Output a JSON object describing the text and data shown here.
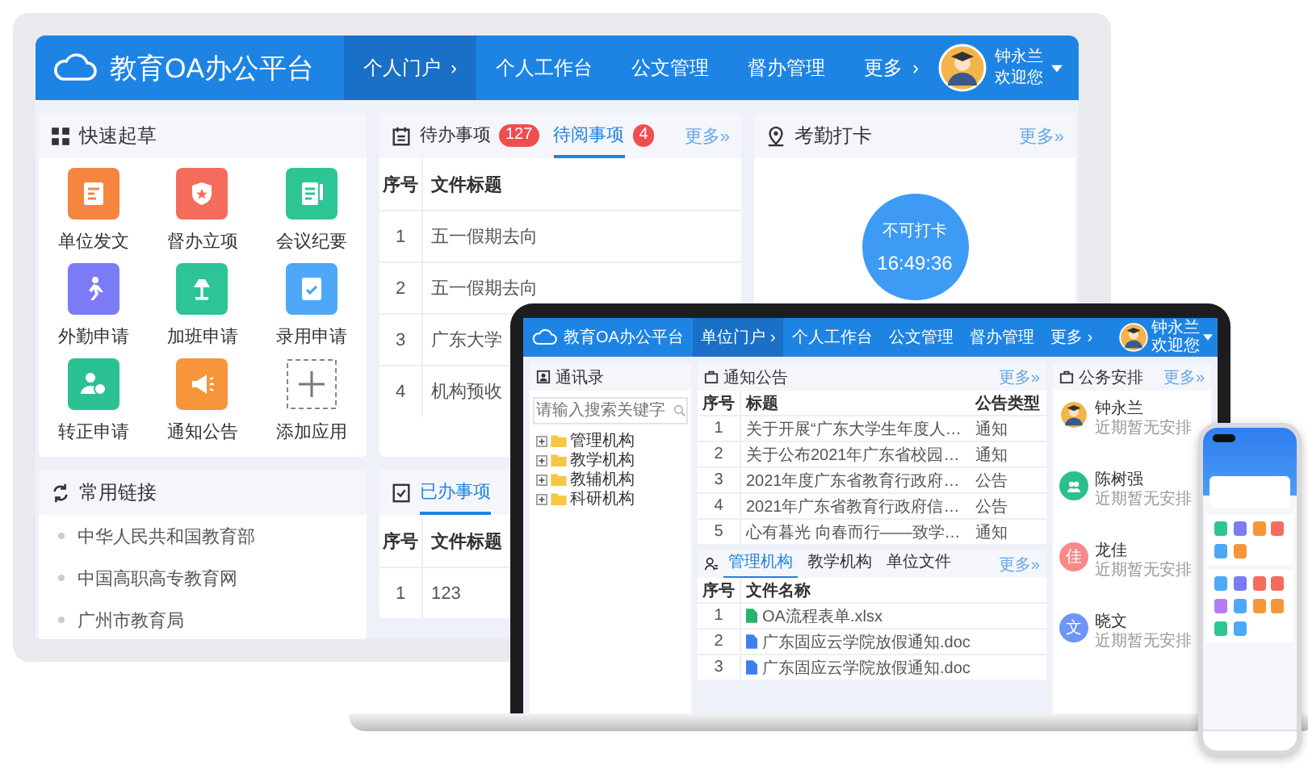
{
  "desktop": {
    "header": {
      "title": "教育OA办公平台",
      "nav": [
        {
          "label": "个人门户",
          "arrow": "›",
          "selected": true
        },
        {
          "label": "个人工作台",
          "selected": false
        },
        {
          "label": "公文管理",
          "selected": false
        },
        {
          "label": "督办管理",
          "selected": false
        },
        {
          "label": "更多",
          "arrow": "›",
          "selected": false
        }
      ],
      "user": {
        "name": "钟永兰",
        "greeting": "欢迎您"
      }
    },
    "quick_draft": {
      "title": "快速起草",
      "apps": [
        {
          "kind": "app",
          "label": "单位发文",
          "color": "#f5853f"
        },
        {
          "kind": "app",
          "label": "督办立项",
          "color": "#f56c5c"
        },
        {
          "kind": "app",
          "label": "会议纪要",
          "color": "#2ec595"
        },
        {
          "kind": "app",
          "label": "外勤申请",
          "color": "#7b7cf5"
        },
        {
          "kind": "app",
          "label": "加班申请",
          "color": "#2dc497"
        },
        {
          "kind": "app",
          "label": "录用申请",
          "color": "#4ea8f7"
        },
        {
          "kind": "app",
          "label": "转正申请",
          "color": "#2bc193"
        },
        {
          "kind": "app",
          "label": "通知公告",
          "color": "#f7953a"
        },
        {
          "kind": "add",
          "label": "添加应用"
        }
      ]
    },
    "links": {
      "title": "常用链接",
      "items": [
        "中华人民共和国教育部",
        "中国高职高专教育网",
        "广州市教育局"
      ]
    },
    "pending": {
      "tabs": [
        {
          "label": "待办事项",
          "badge": "127",
          "selected": false
        },
        {
          "label": "待阅事项",
          "badge": "4",
          "selected": true
        }
      ],
      "more": "更多»",
      "columns": [
        "序号",
        "文件标题"
      ],
      "rows": [
        [
          "1",
          "五一假期去向"
        ],
        [
          "2",
          "五一假期去向"
        ],
        [
          "3",
          "广东大学"
        ],
        [
          "4",
          "机构预收"
        ]
      ]
    },
    "done": {
      "tabs": [
        {
          "label": "已办事项",
          "selected": true
        }
      ],
      "columns": [
        "序号",
        "文件标题"
      ],
      "rows": [
        [
          "1",
          "123"
        ]
      ]
    },
    "attendance": {
      "title": "考勤打卡",
      "more": "更多»",
      "status": "不可打卡",
      "time": "16:49:36"
    }
  },
  "laptop": {
    "header": {
      "title": "教育OA办公平台",
      "nav": [
        {
          "label": "单位门户",
          "arrow": "›",
          "selected": true
        },
        {
          "label": "个人工作台",
          "selected": false
        },
        {
          "label": "公文管理",
          "selected": false
        },
        {
          "label": "督办管理",
          "selected": false
        },
        {
          "label": "更多",
          "arrow": "›",
          "selected": false
        }
      ],
      "user": {
        "name": "钟永兰",
        "greeting": "欢迎您"
      }
    },
    "directory": {
      "title": "通讯录",
      "placeholder": "请输入搜索关键字",
      "tree": [
        {
          "label": "管理机构",
          "expanded": false
        },
        {
          "label": "教学机构",
          "expanded": false
        },
        {
          "label": "教辅机构",
          "expanded": false
        },
        {
          "label": "科研机构",
          "expanded": false
        }
      ]
    },
    "notices": {
      "title": "通知公告",
      "more": "更多»",
      "columns": [
        "序号",
        "标题",
        "公告类型"
      ],
      "rows": [
        [
          "1",
          "关于开展“广东大学生年度人…",
          "通知"
        ],
        [
          "2",
          "关于公布2021年广东省校园…",
          "通知"
        ],
        [
          "3",
          "2021年度广东省教育行政府…",
          "公告"
        ],
        [
          "4",
          "2021年广东省教育行政府信…",
          "公告"
        ],
        [
          "5",
          "心有暮光 向春而行——致学…",
          "通知"
        ]
      ]
    },
    "files": {
      "tabs": [
        {
          "label": "管理机构",
          "selected": true
        },
        {
          "label": "教学机构",
          "selected": false
        },
        {
          "label": "单位文件",
          "selected": false
        }
      ],
      "more": "更多»",
      "columns": [
        "序号",
        "文件名称"
      ],
      "rows": [
        {
          "index": "1",
          "name": "OA流程表单.xlsx",
          "kind": "sheet"
        },
        {
          "index": "2",
          "name": "广东固应云学院放假通知.doc",
          "kind": "doc"
        },
        {
          "index": "3",
          "name": "广东固应云学院放假通知.doc",
          "kind": "doc"
        }
      ]
    },
    "schedule": {
      "title": "公务安排",
      "more": "更多»",
      "people": [
        {
          "kind": "photo",
          "name": "钟永兰",
          "note": "近期暂无安排"
        },
        {
          "kind": "icon",
          "color": "#2bbf8e",
          "name": "陈树强",
          "note": "近期暂无安排"
        },
        {
          "kind": "letter",
          "letter": "佳",
          "color": "#f78a8a",
          "name": "龙佳",
          "note": "近期暂无安排"
        },
        {
          "kind": "letter",
          "letter": "文",
          "color": "#6f94f7",
          "name": "晓文",
          "note": "近期暂无安排"
        }
      ]
    }
  }
}
